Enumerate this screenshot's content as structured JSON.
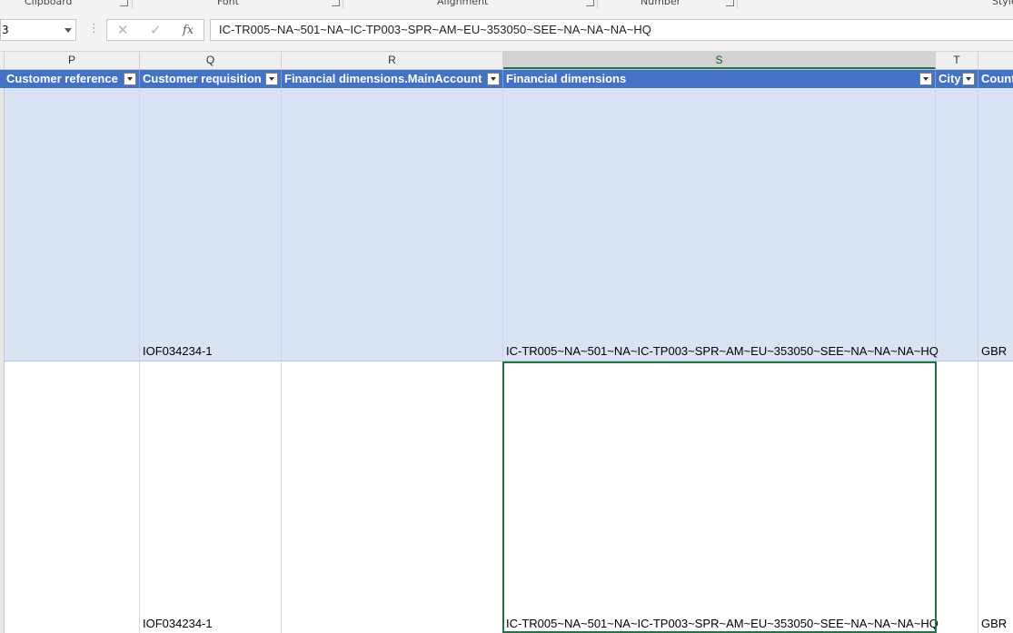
{
  "ribbon": {
    "groups": [
      "Clipboard",
      "Font",
      "Alignment",
      "Number",
      "Styles"
    ]
  },
  "formula_bar": {
    "name_box": "3",
    "cancel_glyph": "✕",
    "enter_glyph": "✓",
    "fx_glyph": "fx",
    "content": "IC-TR005~NA~501~NA~IC-TP003~SPR~AM~EU~353050~SEE~NA~NA~NA~HQ"
  },
  "columns": [
    "P",
    "Q",
    "R",
    "S",
    "T"
  ],
  "selected_column": "S",
  "table_headers": [
    "Customer reference",
    "Customer requisition",
    "Financial dimensions.MainAccount",
    "Financial dimensions",
    "City",
    "Country"
  ],
  "rows": [
    {
      "customer_reference": "",
      "customer_requisition": "IOF034234-1",
      "main_account": "",
      "financial_dimensions": "IC-TR005~NA~501~NA~IC-TP003~SPR~AM~EU~353050~SEE~NA~NA~NA~HQ",
      "city": "",
      "country": "GBR"
    },
    {
      "customer_reference": "",
      "customer_requisition": "IOF034234-1",
      "main_account": "",
      "financial_dimensions": "IC-TR005~NA~501~NA~IC-TP003~SPR~AM~EU~353050~SEE~NA~NA~NA~HQ",
      "city": "",
      "country": "GBR"
    }
  ],
  "colors": {
    "table_header_bg": "#4472c4",
    "banded_row_bg": "#dae3f3",
    "selection_green": "#217346"
  }
}
